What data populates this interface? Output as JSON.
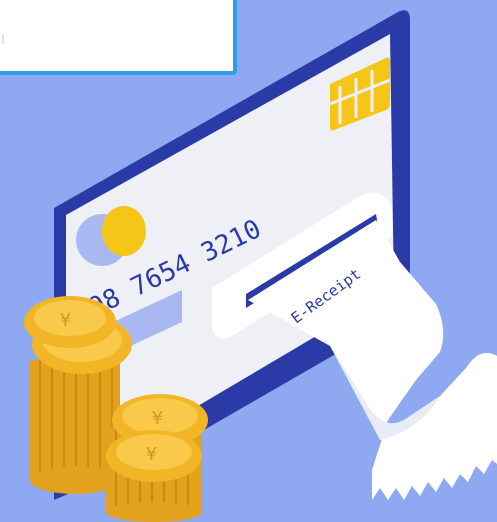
{
  "card": {
    "number_visible": "098  7654  3210"
  },
  "receipt": {
    "label": "E-Receipt"
  },
  "coins": {
    "symbol": "¥"
  },
  "colors": {
    "background": "#8fa8f2",
    "card_body": "#2a3aa6",
    "card_face": "#eef0f5",
    "chip": "#f5c518",
    "coin": "#f2b526",
    "receipt": "#ffffff",
    "panel_border": "#2f9ee8"
  }
}
